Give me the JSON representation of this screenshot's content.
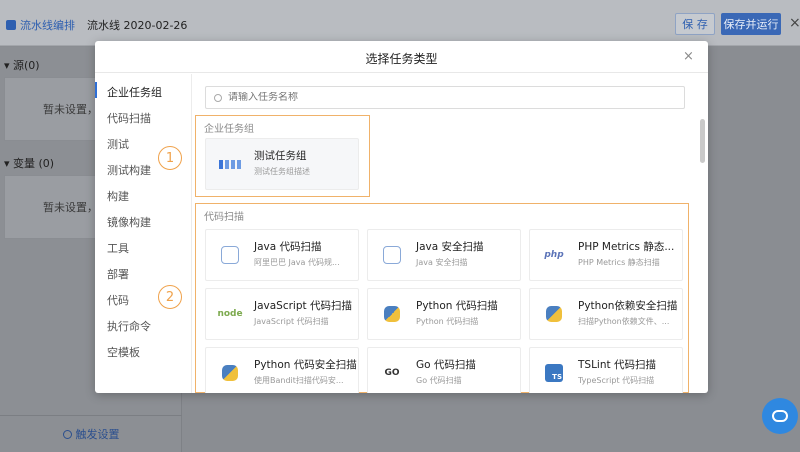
{
  "background": {
    "breadcrumb_link": "流水线编排",
    "pipeline_name": "流水线 2020-02-26",
    "save_label": "保 存",
    "save_run_label": "保存并运行",
    "close_glyph": "×",
    "sections": [
      {
        "label": "▾ 源(0)",
        "empty_text": "暂未设置，点"
      },
      {
        "label": "▾ 变量 (0)",
        "empty_text": "暂未设置，点"
      }
    ],
    "trigger_label": "触发设置"
  },
  "modal": {
    "title": "选择任务类型",
    "close_glyph": "×",
    "search_placeholder": "请输入任务名称",
    "sidebar": [
      "企业任务组",
      "代码扫描",
      "测试",
      "测试构建",
      "构建",
      "镜像构建",
      "工具",
      "部署",
      "代码",
      "执行命令",
      "空模板"
    ],
    "groups": [
      {
        "title": "企业任务组",
        "cards": [
          {
            "name": "测试任务组",
            "desc": "测试任务组描述",
            "icon": "grid-icon"
          }
        ]
      },
      {
        "title": "代码扫描",
        "cards": [
          {
            "name": "Java 代码扫描",
            "desc": "阿里巴巴 Java 代码规...",
            "icon": "java-icon"
          },
          {
            "name": "Java 安全扫描",
            "desc": "Java 安全扫描",
            "icon": "java-icon"
          },
          {
            "name": "PHP Metrics 静态...",
            "desc": "PHP Metrics 静态扫描",
            "icon": "php-icon",
            "icon_text": "php"
          },
          {
            "name": "JavaScript 代码扫描",
            "desc": "JavaScript 代码扫描",
            "icon": "node-icon",
            "icon_text": "node"
          },
          {
            "name": "Python 代码扫描",
            "desc": "Python 代码扫描",
            "icon": "python-icon"
          },
          {
            "name": "Python依赖安全扫描",
            "desc": "扫描Python依赖文件、...",
            "icon": "python-icon"
          },
          {
            "name": "Python 代码安全扫描",
            "desc": "使用Bandit扫描代码安...",
            "icon": "python-icon"
          },
          {
            "name": "Go 代码扫描",
            "desc": "Go 代码扫描",
            "icon": "go-icon",
            "icon_text": "GO"
          },
          {
            "name": "TSLint 代码扫描",
            "desc": "TypeScript 代码扫描",
            "icon": "typescript-icon",
            "icon_text": "TS"
          }
        ]
      }
    ]
  },
  "annotations": [
    "1",
    "2"
  ],
  "colors": {
    "accent": "#2e6fd6",
    "highlight": "#f0a24b"
  }
}
